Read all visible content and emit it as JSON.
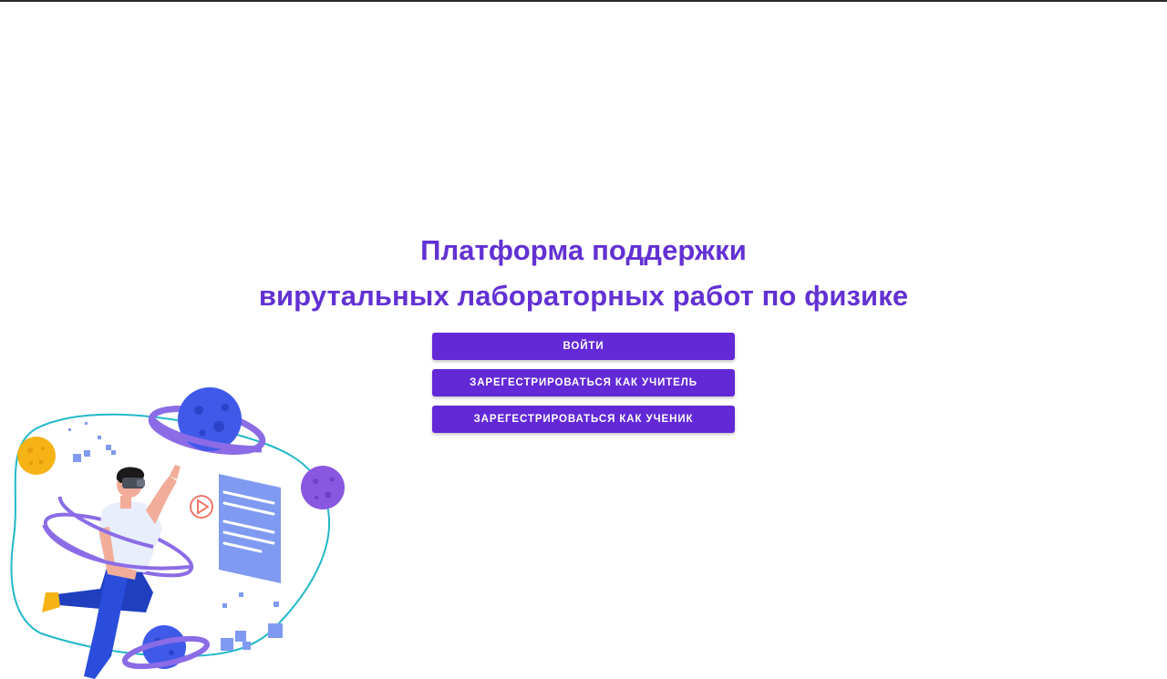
{
  "hero": {
    "title_line1": "Платформа поддержки",
    "title_line2": "вирутальных лабораторных работ по физике"
  },
  "actions": {
    "login_label": "Войти",
    "register_teacher_label": "Зарегестрироваться как учитель",
    "register_student_label": "Зарегестрироваться как ученик"
  },
  "theme": {
    "accent": "#6231d3",
    "button_bg": "#6329d7",
    "button_text": "#ffffff"
  },
  "illustration": {
    "subject": "person-with-vr-headset-among-planets",
    "icons": [
      "planet-icon",
      "play-icon",
      "document-icon",
      "vr-headset-icon"
    ]
  }
}
